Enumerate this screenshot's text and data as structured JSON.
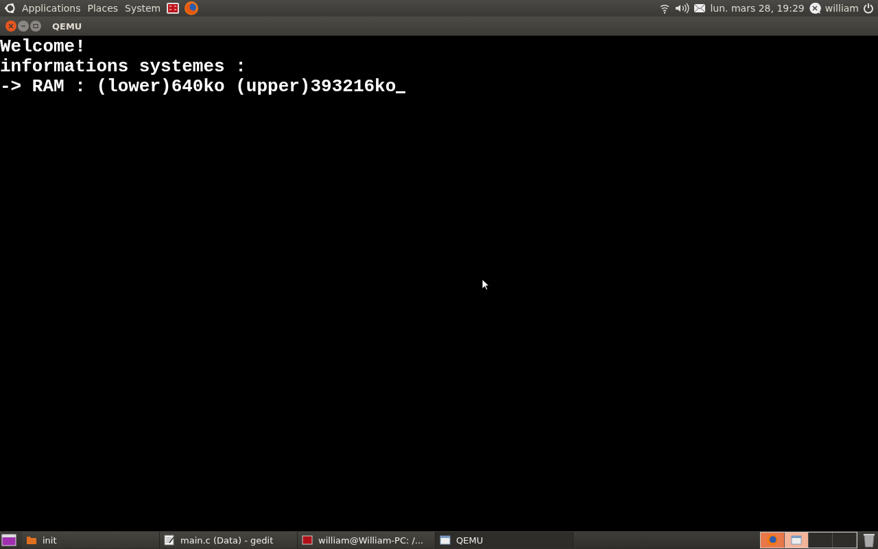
{
  "top_panel": {
    "menus": [
      "Applications",
      "Places",
      "System"
    ],
    "clock": "lun. mars 28, 19:29",
    "user": "william"
  },
  "window": {
    "title": "QEMU"
  },
  "console": {
    "lines": [
      "Welcome!",
      "informations systemes :",
      "-> RAM : (lower)640ko (upper)393216ko"
    ]
  },
  "taskbar": {
    "tasks": [
      {
        "label": "init",
        "selected": false
      },
      {
        "label": "main.c (Data) - gedit",
        "selected": false
      },
      {
        "label": "william@William-PC: /...",
        "selected": false
      },
      {
        "label": "QEMU",
        "selected": true
      }
    ]
  }
}
